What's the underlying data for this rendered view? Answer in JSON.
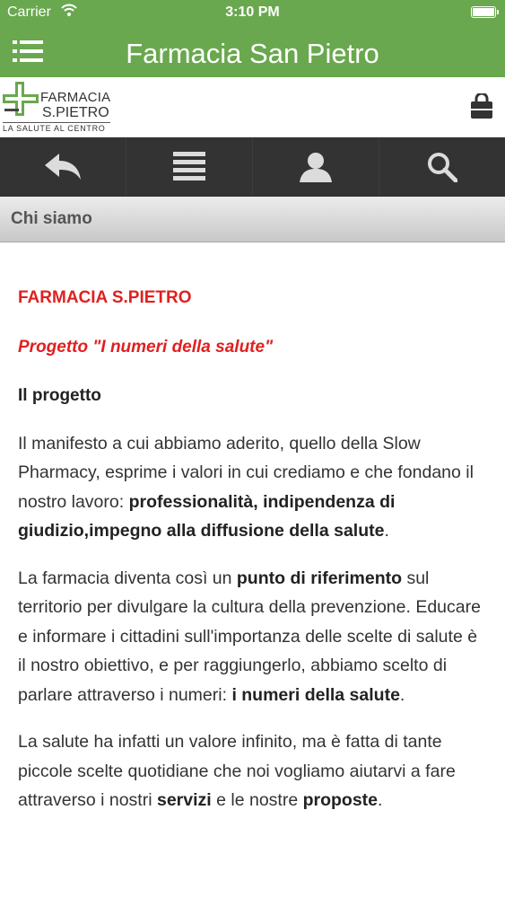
{
  "status_bar": {
    "carrier": "Carrier",
    "time": "3:10 PM"
  },
  "nav": {
    "title": "Farmacia San Pietro"
  },
  "logo": {
    "line1": "FARMACIA",
    "line2": "S.PIETRO",
    "tagline": "LA SALUTE AL CENTRO"
  },
  "toolbar": {
    "items": [
      "back-icon",
      "list-icon",
      "user-icon",
      "search-icon"
    ]
  },
  "section": {
    "title": "Chi siamo"
  },
  "colors": {
    "brand_green": "#6aa84f",
    "toolbar_dark": "#333333",
    "heading_red": "#e02020"
  },
  "content": {
    "company": "FARMACIA S.PIETRO",
    "project": "Progetto \"I numeri della salute\"",
    "subtitle": "Il progetto",
    "p1_a": "Il manifesto a cui abbiamo aderito, quello della Slow Pharmacy, esprime i valori in cui crediamo e che fondano il nostro lavoro: ",
    "p1_b": "professionalità, indipendenza di giudizio,impegno alla diffusione della salute",
    "p1_c": ".",
    "p2_a": "La farmacia diventa così un ",
    "p2_b": "punto di riferimento",
    "p2_c": " sul territorio per divulgare la cultura della prevenzione. Educare e informare i cittadini sull'importanza delle scelte di salute è il nostro obiettivo, e per raggiungerlo, abbiamo scelto di parlare attraverso i numeri: ",
    "p2_d": "i numeri della salute",
    "p2_e": ".",
    "p3_a": "La salute ha infatti un valore infinito, ma è fatta di tante piccole scelte quotidiane che noi vogliamo aiutarvi a fare attraverso i nostri ",
    "p3_b": "servizi",
    "p3_c": " e le nostre ",
    "p3_d": "proposte",
    "p3_e": "."
  }
}
